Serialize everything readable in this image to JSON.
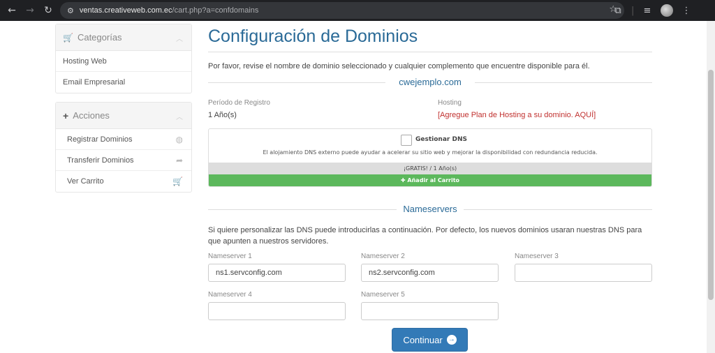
{
  "browser": {
    "url_host": "ventas.creativeweb.com.ec",
    "url_path": "/cart.php?a=confdomains"
  },
  "sidebar": {
    "categories": {
      "title": "Categorías",
      "items": [
        {
          "label": "Hosting Web"
        },
        {
          "label": "Email Empresarial"
        }
      ]
    },
    "actions": {
      "title": "Acciones",
      "items": [
        {
          "label": "Registrar Dominios",
          "icon": "globe-icon"
        },
        {
          "label": "Transferir Dominios",
          "icon": "share-arrow-icon"
        },
        {
          "label": "Ver Carrito",
          "icon": "cart-icon"
        }
      ]
    }
  },
  "main": {
    "title": "Configuración de Dominios",
    "intro": "Por favor, revise el nombre de dominio seleccionado y cualquier complemento que encuentre disponible para él.",
    "domain": "cwejemplo.com",
    "period_label": "Período de Registro",
    "period_value": "1 Año(s)",
    "hosting_label": "Hosting",
    "hosting_link": "[Agregue Plan de Hosting a su dominio. AQUÍ]",
    "addon": {
      "name": "Gestionar DNS",
      "description": "El alojamiento DNS externo puede ayudar a acelerar su sitio web y mejorar la disponibilidad con redundancia reducida.",
      "price": "¡GRATIS! / 1 Año(s)",
      "add_label": "Añadir al Carrito"
    },
    "nameservers": {
      "title": "Nameservers",
      "description": "Si quiere personalizar las DNS puede introducirlas a continuación. Por defecto, los nuevos dominios usaran nuestras DNS para que apunten a nuestros servidores.",
      "fields": [
        {
          "label": "Nameserver 1",
          "value": "ns1.servconfig.com"
        },
        {
          "label": "Nameserver 2",
          "value": "ns2.servconfig.com"
        },
        {
          "label": "Nameserver 3",
          "value": ""
        },
        {
          "label": "Nameserver 4",
          "value": ""
        },
        {
          "label": "Nameserver 5",
          "value": ""
        }
      ]
    },
    "continue_label": "Continuar"
  },
  "colors": {
    "accent": "#2a6a97",
    "button_blue": "#337ab7",
    "add_green": "#5cb85c",
    "link_red": "#c0302e"
  }
}
